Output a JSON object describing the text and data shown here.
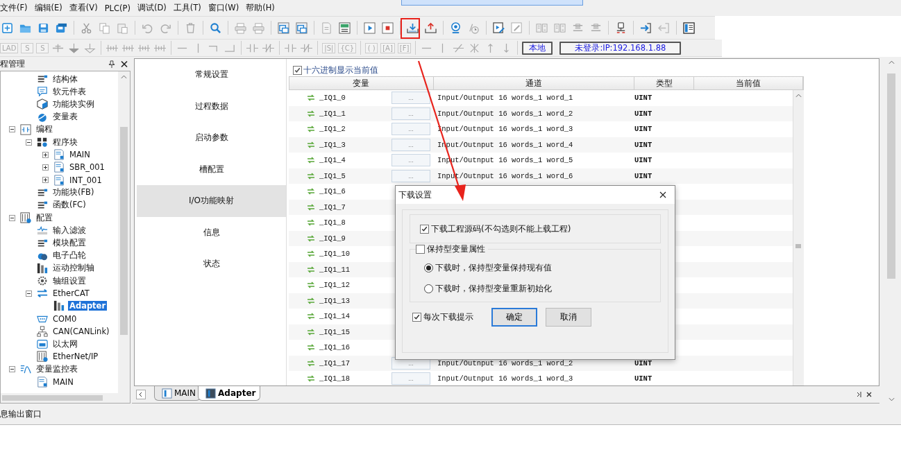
{
  "menu": [
    {
      "label": "文件(F)"
    },
    {
      "label": "编辑(E)"
    },
    {
      "label": "查看(V)"
    },
    {
      "label": "PLC(P)"
    },
    {
      "label": "调试(D)"
    },
    {
      "label": "工具(T)"
    },
    {
      "label": "窗口(W)"
    },
    {
      "label": "帮助(H)"
    }
  ],
  "ladder_toolbar": [
    {
      "label": "LAD",
      "disabled": true
    },
    {
      "label": "S",
      "disabled": true
    },
    {
      "label": "S",
      "disabled": true
    },
    {
      "label": "|S|",
      "disabled": true
    },
    {
      "label": "{C}",
      "disabled": true
    },
    {
      "label": "( )",
      "disabled": true
    },
    {
      "label": "[A]",
      "disabled": true
    },
    {
      "label": "[F]",
      "disabled": true
    }
  ],
  "connection": {
    "mode": "本地",
    "status": "未登录:IP:192.168.1.88"
  },
  "project_panel": {
    "title": "程管理",
    "tree": {
      "continued_items": [
        {
          "label": "结构体"
        },
        {
          "label": "软元件表"
        },
        {
          "label": "功能块实例"
        },
        {
          "label": "变量表"
        }
      ],
      "items": [
        {
          "label": "编程",
          "expanded": true,
          "children": [
            {
              "label": "程序块",
              "expanded": true,
              "children": [
                {
                  "label": "MAIN",
                  "expanded": false
                },
                {
                  "label": "SBR_001",
                  "expanded": false
                },
                {
                  "label": "INT_001",
                  "expanded": false
                }
              ]
            },
            {
              "label": "功能块(FB)"
            },
            {
              "label": "函数(FC)"
            }
          ]
        },
        {
          "label": "配置",
          "expanded": true,
          "children": [
            {
              "label": "输入滤波"
            },
            {
              "label": "模块配置"
            },
            {
              "label": "电子凸轮"
            },
            {
              "label": "运动控制轴"
            },
            {
              "label": "轴组设置"
            },
            {
              "label": "EtherCAT",
              "expanded": true,
              "children": [
                {
                  "label": "Adapter",
                  "selected": true
                }
              ]
            },
            {
              "label": "COM0"
            },
            {
              "label": "CAN(CANLink)"
            },
            {
              "label": "以太网"
            },
            {
              "label": "EtherNet/IP"
            }
          ]
        },
        {
          "label": "变量监控表",
          "expanded": true,
          "children": [
            {
              "label": "MAIN"
            }
          ]
        }
      ]
    }
  },
  "config_nav": [
    {
      "label": "常规设置",
      "selected": false
    },
    {
      "label": "过程数据",
      "selected": false
    },
    {
      "label": "启动参数",
      "selected": false
    },
    {
      "label": "槽配置",
      "selected": false
    },
    {
      "label": "I/O功能映射",
      "selected": true
    },
    {
      "label": "信息",
      "selected": false
    },
    {
      "label": "状态",
      "selected": false
    }
  ],
  "hex_display": {
    "label": "十六进制显示当前值",
    "checked": true
  },
  "table": {
    "columns": [
      "变量",
      "通道",
      "类型",
      "当前值"
    ],
    "rows": [
      {
        "variable": "_IQ1_0",
        "browse": "...",
        "channel": "Input/Outnput 16 words_1 word_1",
        "type": "UINT"
      },
      {
        "variable": "_IQ1_1",
        "browse": "...",
        "channel": "Input/Outnput 16 words_1 word_2",
        "type": "UINT"
      },
      {
        "variable": "_IQ1_2",
        "browse": "...",
        "channel": "Input/Outnput 16 words_1 word_3",
        "type": "UINT"
      },
      {
        "variable": "_IQ1_3",
        "browse": "...",
        "channel": "Input/Outnput 16 words_1 word_4",
        "type": "UINT"
      },
      {
        "variable": "_IQ1_4",
        "browse": "...",
        "channel": "Input/Outnput 16 words_1 word_5",
        "type": "UINT"
      },
      {
        "variable": "_IQ1_5",
        "browse": "...",
        "channel": "Input/Outnput 16 words_1 word_6",
        "type": "UINT"
      },
      {
        "variable": "_IQ1_6"
      },
      {
        "variable": "_IQ1_7"
      },
      {
        "variable": "_IQ1_8"
      },
      {
        "variable": "_IQ1_9"
      },
      {
        "variable": "_IQ1_10"
      },
      {
        "variable": "_IQ1_11"
      },
      {
        "variable": "_IQ1_12"
      },
      {
        "variable": "_IQ1_13"
      },
      {
        "variable": "_IQ1_14"
      },
      {
        "variable": "_IQ1_15"
      },
      {
        "variable": "_IQ1_16"
      },
      {
        "variable": "_IQ1_17",
        "browse": "...",
        "channel": "Input/Outnput 16 words_1 word_2",
        "type": "UINT"
      },
      {
        "variable": "_IQ1_18",
        "browse": "...",
        "channel": "Input/Outnput 16 words_1 word_3",
        "type": "UINT"
      }
    ]
  },
  "editor_tabs": [
    {
      "label": "MAIN",
      "selected": false
    },
    {
      "label": "Adapter",
      "selected": true
    }
  ],
  "output_window": {
    "title": "息输出窗口"
  },
  "dialog": {
    "title": "下载设置",
    "source_option": {
      "label": "下载工程源码(不勾选则不能上载工程)",
      "checked": true
    },
    "retain_group": {
      "label": "保持型变量属性",
      "checked": false,
      "options": [
        {
          "label": "下载时，保持型变量保持现有值",
          "selected": true
        },
        {
          "label": "下载时，保持型变量重新初始化",
          "selected": false
        }
      ]
    },
    "prompt_option": {
      "label": "每次下载提示",
      "checked": true
    },
    "buttons": [
      {
        "label": "确定",
        "default": true
      },
      {
        "label": "取消",
        "default": false
      }
    ]
  }
}
